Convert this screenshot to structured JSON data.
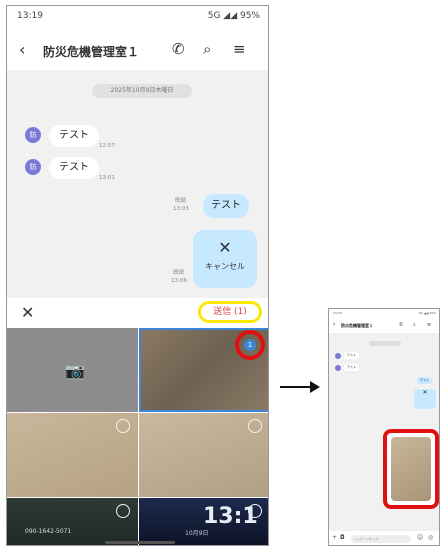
{
  "main_phone": {
    "status_time": "13:19",
    "status_right": "5G ◢◢ 95%",
    "header": {
      "title": "防災危機管理室１",
      "back_glyph": "‹",
      "phone_glyph": "✆",
      "search_glyph": "⌕",
      "menu_glyph": "≡"
    },
    "date_chip": "2025年10月9日木曜日",
    "avatar_label": "防",
    "messages_in": [
      {
        "text": "テスト",
        "time": "12:57"
      },
      {
        "text": "テスト",
        "time": "13:01"
      }
    ],
    "messages_out": [
      {
        "text": "テスト",
        "status": "既読",
        "time": "13:03"
      }
    ],
    "cancel_message": {
      "icon": "✕",
      "label": "キャンセル",
      "status": "既読",
      "time": "13:06"
    },
    "select_bar": {
      "close_glyph": "✕",
      "send_label": "送信 (1)"
    },
    "grid": {
      "camera_glyph": "📷",
      "selected_count": "1",
      "photo4_caption": "090-1642-5071",
      "photo5_big": "13:1",
      "photo5_small": "10月9日"
    }
  },
  "mini_phone": {
    "time": "13:20",
    "right": "5G ◢◢ 95%",
    "title": "防災危機管理室１",
    "in1": "テスト",
    "in2": "テスト",
    "out1": "テスト",
    "cancel_glyph": "✕",
    "input_placeholder": "メッセージを入力",
    "plus": "+",
    "icons": [
      "☺",
      "◎"
    ]
  }
}
